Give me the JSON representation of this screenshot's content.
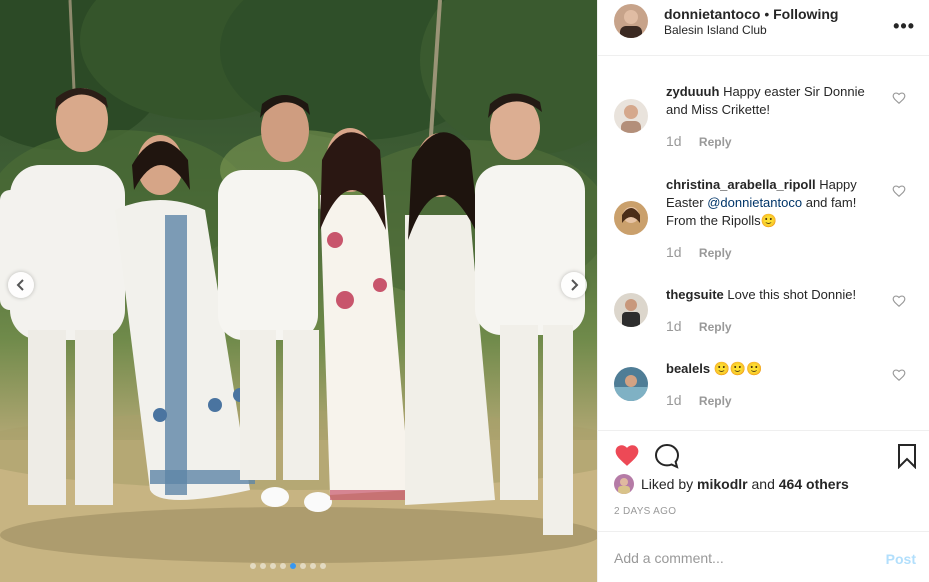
{
  "post": {
    "username": "donnietantoco",
    "bullet": "•",
    "follow_status": "Following",
    "location": "Balesin Island Club",
    "more_icon": "more-options-icon"
  },
  "carousel": {
    "total_slides": 8,
    "current_slide": 5
  },
  "comments": [
    {
      "username": "zyduuuh",
      "text": "Happy easter Sir Donnie and Miss Crikette!",
      "time": "1d",
      "reply_label": "Reply"
    },
    {
      "username": "christina_arabella_ripoll",
      "text_before": "Happy Easter",
      "mention": "@donnietantoco",
      "text_after": "and fam! From the Ripolls🙂",
      "time": "1d",
      "reply_label": "Reply"
    },
    {
      "username": "thegsuite",
      "text": "Love this shot Donnie!",
      "time": "1d",
      "reply_label": "Reply"
    },
    {
      "username": "bealels",
      "text": "🙂🙂🙂",
      "time": "1d",
      "reply_label": "Reply"
    }
  ],
  "likes": {
    "prefix": "Liked by",
    "user": "mikodlr",
    "conjunction": "and",
    "others": "464 others"
  },
  "date": "2 DAYS AGO",
  "add_comment": {
    "placeholder": "Add a comment...",
    "post_label": "Post"
  },
  "colors": {
    "liked_heart": "#ed4956",
    "mention": "#003569",
    "post_disabled": "#b2dffc",
    "meta_gray": "#999999"
  }
}
